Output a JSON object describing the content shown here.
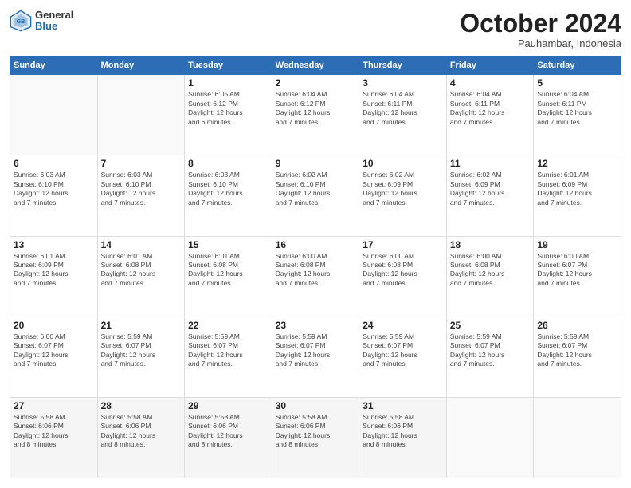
{
  "logo": {
    "general": "General",
    "blue": "Blue"
  },
  "header": {
    "month": "October 2024",
    "location": "Pauhambar, Indonesia"
  },
  "days_of_week": [
    "Sunday",
    "Monday",
    "Tuesday",
    "Wednesday",
    "Thursday",
    "Friday",
    "Saturday"
  ],
  "weeks": [
    [
      {
        "day": "",
        "info": ""
      },
      {
        "day": "",
        "info": ""
      },
      {
        "day": "1",
        "info": "Sunrise: 6:05 AM\nSunset: 6:12 PM\nDaylight: 12 hours\nand 6 minutes."
      },
      {
        "day": "2",
        "info": "Sunrise: 6:04 AM\nSunset: 6:12 PM\nDaylight: 12 hours\nand 7 minutes."
      },
      {
        "day": "3",
        "info": "Sunrise: 6:04 AM\nSunset: 6:11 PM\nDaylight: 12 hours\nand 7 minutes."
      },
      {
        "day": "4",
        "info": "Sunrise: 6:04 AM\nSunset: 6:11 PM\nDaylight: 12 hours\nand 7 minutes."
      },
      {
        "day": "5",
        "info": "Sunrise: 6:04 AM\nSunset: 6:11 PM\nDaylight: 12 hours\nand 7 minutes."
      }
    ],
    [
      {
        "day": "6",
        "info": "Sunrise: 6:03 AM\nSunset: 6:10 PM\nDaylight: 12 hours\nand 7 minutes."
      },
      {
        "day": "7",
        "info": "Sunrise: 6:03 AM\nSunset: 6:10 PM\nDaylight: 12 hours\nand 7 minutes."
      },
      {
        "day": "8",
        "info": "Sunrise: 6:03 AM\nSunset: 6:10 PM\nDaylight: 12 hours\nand 7 minutes."
      },
      {
        "day": "9",
        "info": "Sunrise: 6:02 AM\nSunset: 6:10 PM\nDaylight: 12 hours\nand 7 minutes."
      },
      {
        "day": "10",
        "info": "Sunrise: 6:02 AM\nSunset: 6:09 PM\nDaylight: 12 hours\nand 7 minutes."
      },
      {
        "day": "11",
        "info": "Sunrise: 6:02 AM\nSunset: 6:09 PM\nDaylight: 12 hours\nand 7 minutes."
      },
      {
        "day": "12",
        "info": "Sunrise: 6:01 AM\nSunset: 6:09 PM\nDaylight: 12 hours\nand 7 minutes."
      }
    ],
    [
      {
        "day": "13",
        "info": "Sunrise: 6:01 AM\nSunset: 6:09 PM\nDaylight: 12 hours\nand 7 minutes."
      },
      {
        "day": "14",
        "info": "Sunrise: 6:01 AM\nSunset: 6:08 PM\nDaylight: 12 hours\nand 7 minutes."
      },
      {
        "day": "15",
        "info": "Sunrise: 6:01 AM\nSunset: 6:08 PM\nDaylight: 12 hours\nand 7 minutes."
      },
      {
        "day": "16",
        "info": "Sunrise: 6:00 AM\nSunset: 6:08 PM\nDaylight: 12 hours\nand 7 minutes."
      },
      {
        "day": "17",
        "info": "Sunrise: 6:00 AM\nSunset: 6:08 PM\nDaylight: 12 hours\nand 7 minutes."
      },
      {
        "day": "18",
        "info": "Sunrise: 6:00 AM\nSunset: 6:08 PM\nDaylight: 12 hours\nand 7 minutes."
      },
      {
        "day": "19",
        "info": "Sunrise: 6:00 AM\nSunset: 6:07 PM\nDaylight: 12 hours\nand 7 minutes."
      }
    ],
    [
      {
        "day": "20",
        "info": "Sunrise: 6:00 AM\nSunset: 6:07 PM\nDaylight: 12 hours\nand 7 minutes."
      },
      {
        "day": "21",
        "info": "Sunrise: 5:59 AM\nSunset: 6:07 PM\nDaylight: 12 hours\nand 7 minutes."
      },
      {
        "day": "22",
        "info": "Sunrise: 5:59 AM\nSunset: 6:07 PM\nDaylight: 12 hours\nand 7 minutes."
      },
      {
        "day": "23",
        "info": "Sunrise: 5:59 AM\nSunset: 6:07 PM\nDaylight: 12 hours\nand 7 minutes."
      },
      {
        "day": "24",
        "info": "Sunrise: 5:59 AM\nSunset: 6:07 PM\nDaylight: 12 hours\nand 7 minutes."
      },
      {
        "day": "25",
        "info": "Sunrise: 5:59 AM\nSunset: 6:07 PM\nDaylight: 12 hours\nand 7 minutes."
      },
      {
        "day": "26",
        "info": "Sunrise: 5:59 AM\nSunset: 6:07 PM\nDaylight: 12 hours\nand 7 minutes."
      }
    ],
    [
      {
        "day": "27",
        "info": "Sunrise: 5:58 AM\nSunset: 6:06 PM\nDaylight: 12 hours\nand 8 minutes."
      },
      {
        "day": "28",
        "info": "Sunrise: 5:58 AM\nSunset: 6:06 PM\nDaylight: 12 hours\nand 8 minutes."
      },
      {
        "day": "29",
        "info": "Sunrise: 5:58 AM\nSunset: 6:06 PM\nDaylight: 12 hours\nand 8 minutes."
      },
      {
        "day": "30",
        "info": "Sunrise: 5:58 AM\nSunset: 6:06 PM\nDaylight: 12 hours\nand 8 minutes."
      },
      {
        "day": "31",
        "info": "Sunrise: 5:58 AM\nSunset: 6:06 PM\nDaylight: 12 hours\nand 8 minutes."
      },
      {
        "day": "",
        "info": ""
      },
      {
        "day": "",
        "info": ""
      }
    ]
  ]
}
